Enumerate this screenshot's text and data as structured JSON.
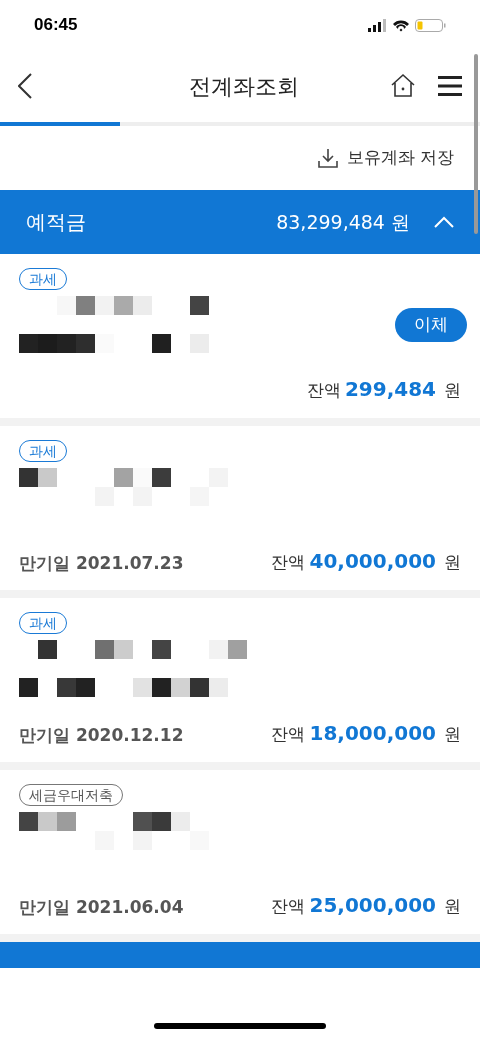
{
  "status_bar": {
    "time": "06:45"
  },
  "header": {
    "title": "전계좌조회"
  },
  "tab_indicator": {
    "level": 0.25
  },
  "save_button": {
    "label": "보유계좌 저장"
  },
  "section": {
    "title": "예적금",
    "total": "83,299,484 원",
    "expanded": true
  },
  "accounts": [
    {
      "tag": {
        "kind": "tax",
        "label": "과세"
      },
      "transfer_button": "이체",
      "balance_label": "잔액",
      "balance": "299,484",
      "currency": "원"
    },
    {
      "tag": {
        "kind": "tax",
        "label": "과세"
      },
      "maturity": "만기일 2021.07.23",
      "balance_label": "잔액",
      "balance": "40,000,000",
      "currency": "원"
    },
    {
      "tag": {
        "kind": "tax",
        "label": "과세"
      },
      "maturity": "만기일 2020.12.12",
      "balance_label": "잔액",
      "balance": "18,000,000",
      "currency": "원"
    },
    {
      "tag": {
        "kind": "tax-benefit",
        "label": "세금우대저축"
      },
      "maturity": "만기일 2021.06.04",
      "balance_label": "잔액",
      "balance": "25,000,000",
      "currency": "원"
    }
  ]
}
